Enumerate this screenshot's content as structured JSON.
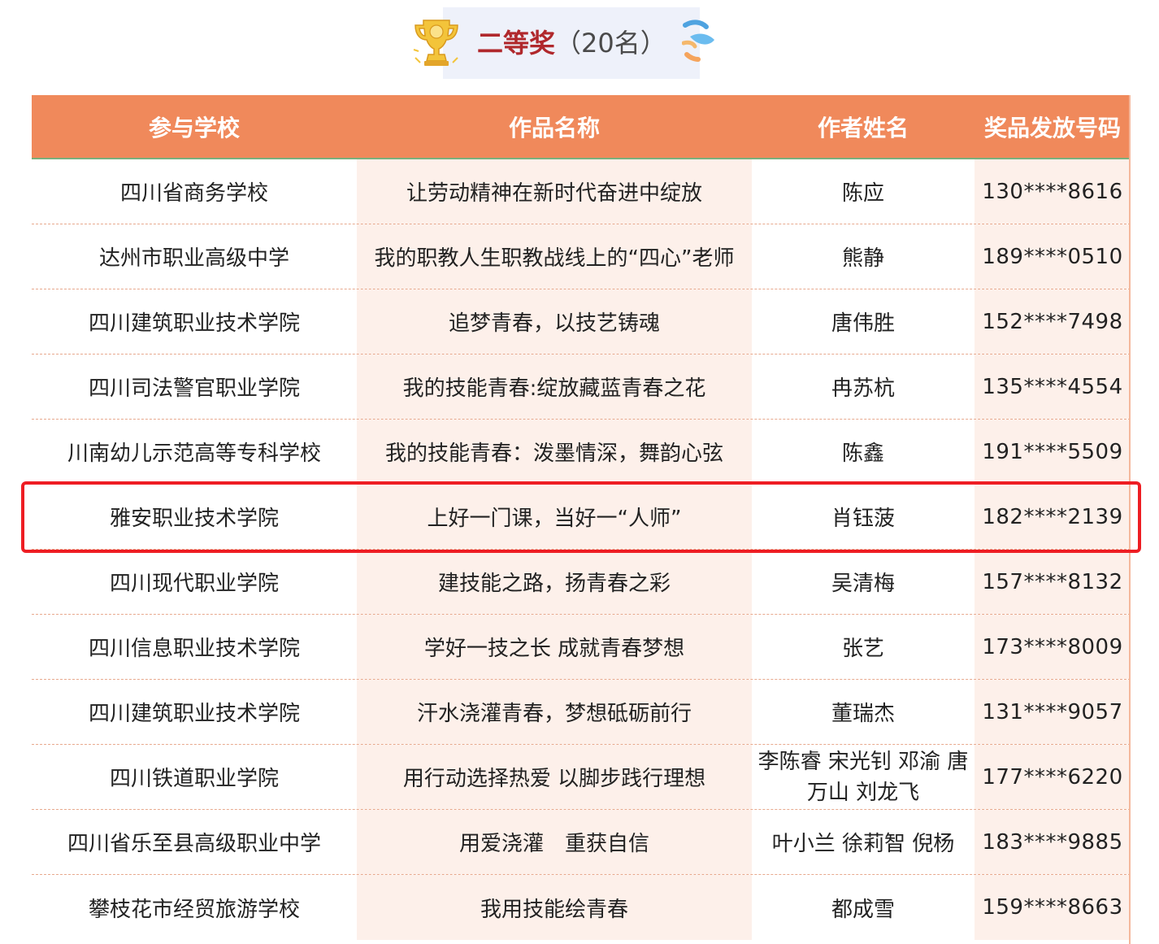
{
  "header": {
    "title_main": "二等奖",
    "title_count": "（20名）",
    "left_icon": "trophy-icon",
    "right_icon": "splash-icon"
  },
  "table": {
    "columns": [
      "参与学校",
      "作品名称",
      "作者姓名",
      "奖品发放号码"
    ],
    "rows": [
      {
        "school": "四川省商务学校",
        "work": "让劳动精神在新时代奋进中绽放",
        "author": "陈应",
        "code": "130****8616"
      },
      {
        "school": "达州市职业高级中学",
        "work": "我的职教人生职教战线上的“四心”老师",
        "author": "熊静",
        "code": "189****0510"
      },
      {
        "school": "四川建筑职业技术学院",
        "work": "追梦青春，以技艺铸魂",
        "author": "唐伟胜",
        "code": "152****7498"
      },
      {
        "school": "四川司法警官职业学院",
        "work": "我的技能青春:绽放藏蓝青春之花",
        "author": "冉苏杭",
        "code": "135****4554"
      },
      {
        "school": "川南幼儿示范高等专科学校",
        "work": "我的技能青春：泼墨情深，舞韵心弦",
        "author": "陈鑫",
        "code": "191****5509"
      },
      {
        "school": "雅安职业技术学院",
        "work": "上好一门课，当好一“人师”",
        "author": "肖钰菠",
        "code": "182****2139"
      },
      {
        "school": "四川现代职业学院",
        "work": "建技能之路，扬青春之彩",
        "author": "吴清梅",
        "code": "157****8132"
      },
      {
        "school": "四川信息职业技术学院",
        "work": "学好一技之长 成就青春梦想",
        "author": "张艺",
        "code": "173****8009"
      },
      {
        "school": "四川建筑职业技术学院",
        "work": "汗水浇灌青春，梦想砥砺前行",
        "author": "董瑞杰",
        "code": "131****9057"
      },
      {
        "school": "四川铁道职业学院",
        "work": "用行动选择热爱 以脚步践行理想",
        "author": "李陈睿 宋光钊 邓渝 唐万山 刘龙飞",
        "code": "177****6220"
      },
      {
        "school": "四川省乐至县高级职业中学",
        "work": "用爱浇灌　重获自信",
        "author": "叶小兰 徐莉智 倪杨",
        "code": "183****9885"
      },
      {
        "school": "攀枝花市经贸旅游学校",
        "work": "我用技能绘青春",
        "author": "都成雪",
        "code": "159****8663"
      }
    ]
  },
  "colors": {
    "header_bg": "#f0895b",
    "stripe_bg": "#fdf0ea",
    "title_red": "#b0282c",
    "highlight": "#ee1d23"
  }
}
